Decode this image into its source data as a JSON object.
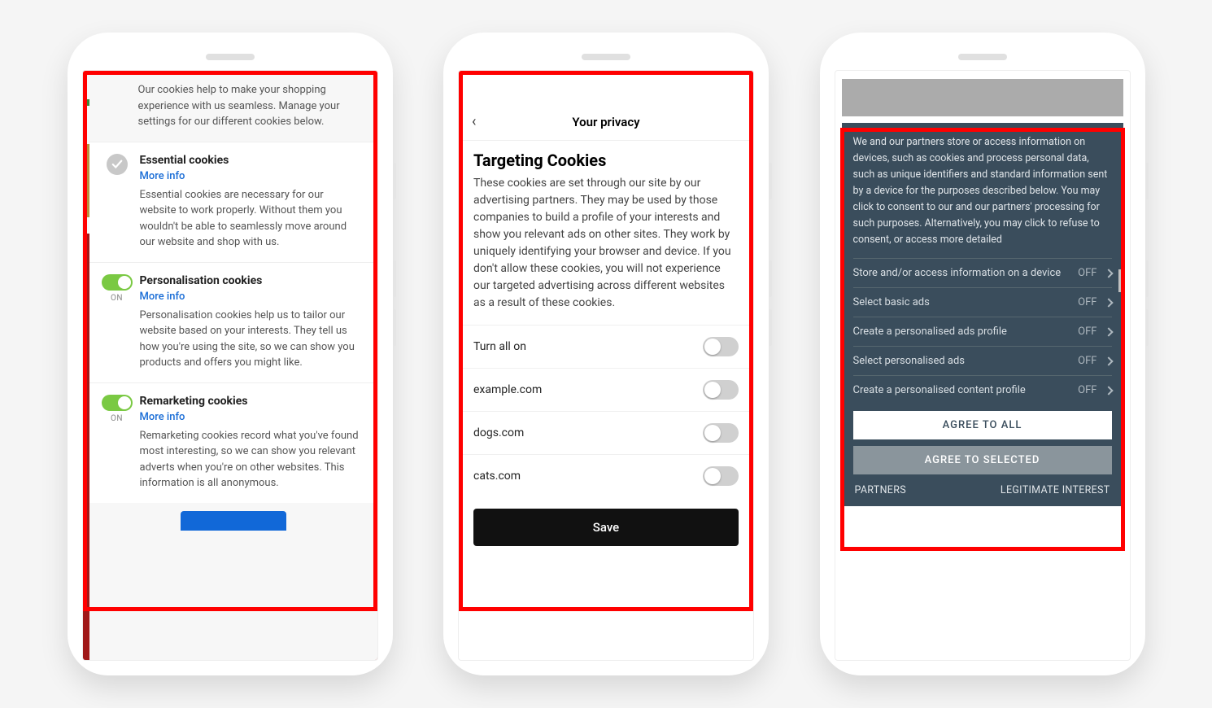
{
  "phone1": {
    "intro": "Our cookies help to make your shopping experience with us seamless. Manage your settings for our different cookies below.",
    "moreInfo": "More info",
    "onLabel": "ON",
    "sections": [
      {
        "title": "Essential cookies",
        "desc": "Essential cookies are necessary for our website to work properly. Without them you wouldn't be able to seamlessly move around our website and shop with us."
      },
      {
        "title": "Personalisation cookies",
        "desc": "Personalisation cookies help us to tailor our website based on your interests. They tell us how you're using the site, so we can show you products and offers you might like."
      },
      {
        "title": "Remarketing cookies",
        "desc": "Remarketing cookies record what you've found most interesting, so we can show you relevant adverts when you're on other websites. This information is all anonymous."
      }
    ]
  },
  "phone2": {
    "headerTitle": "Your privacy",
    "heading": "Targeting Cookies",
    "paragraph": "These cookies are set through our site by our advertising partners. They may be used by those companies to build a profile of your interests and show you relevant ads on other sites. They work by uniquely identifying your browser and device. If you don't allow these cookies, you will not experience our targeted advertising across different websites as a result of these cookies.",
    "turnAll": "Turn all on",
    "rows": [
      "example.com",
      "dogs.com",
      "cats.com"
    ],
    "save": "Save"
  },
  "phone3": {
    "intro": "We and our partners store or access information on devices, such as cookies and process personal data, such as unique identifiers and standard information sent by a device for the purposes described below. You may click to consent to our and our partners' processing for such purposes. Alternatively, you may click to refuse to consent, or access more detailed",
    "offLabel": "OFF",
    "items": [
      "Store and/or access information on a device",
      "Select basic ads",
      "Create a personalised ads profile",
      "Select personalised ads",
      "Create a personalised content profile"
    ],
    "agreeAll": "AGREE TO ALL",
    "agreeSelected": "AGREE TO SELECTED",
    "partners": "PARTNERS",
    "legit": "LEGITIMATE INTEREST"
  }
}
